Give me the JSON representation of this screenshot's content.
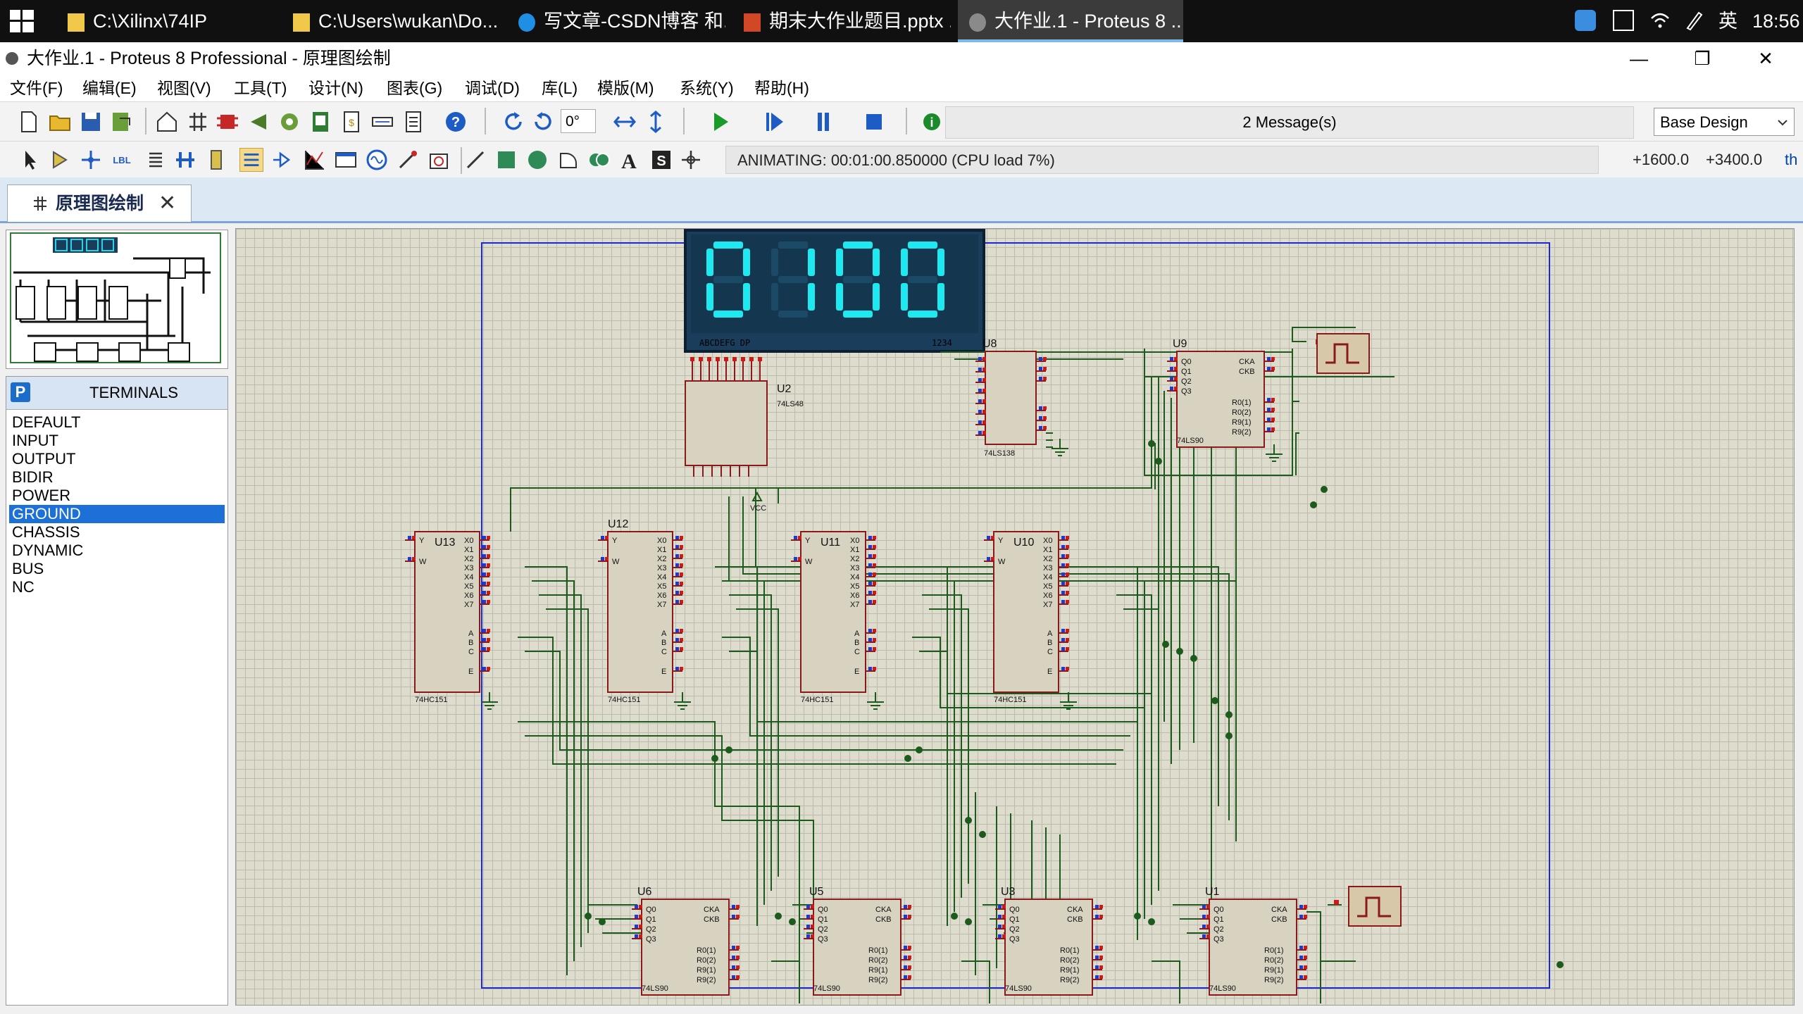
{
  "taskbar": {
    "items": [
      {
        "label": "C:\\Xilinx\\74IP",
        "icon": "folder-icon"
      },
      {
        "label": "C:\\Users\\wukan\\Do...",
        "icon": "folder-icon"
      },
      {
        "label": "写文章-CSDN博客 和...",
        "icon": "edge-browser-icon"
      },
      {
        "label": "期末大作业题目.pptx ...",
        "icon": "powerpoint-icon"
      },
      {
        "label": "大作业.1 - Proteus 8 ...",
        "icon": "proteus-icon"
      }
    ],
    "ime": "英",
    "clock": "18:56"
  },
  "window": {
    "title": "大作业.1 - Proteus 8 Professional - 原理图绘制",
    "minimize": "—",
    "restore": "❐",
    "close": "✕"
  },
  "menu": [
    "文件(F)",
    "编辑(E)",
    "视图(V)",
    "工具(T)",
    "设计(N)",
    "图表(G)",
    "调试(D)",
    "库(L)",
    "模版(M)",
    "系统(Y)",
    "帮助(H)"
  ],
  "toolbar": {
    "rotation": "0°",
    "messages": "2 Message(s)",
    "design": "Base Design"
  },
  "status": {
    "animating": "ANIMATING: 00:01:00.850000 (CPU load 7%)",
    "x": "+1600.0",
    "y": "+3400.0",
    "unit": "th"
  },
  "tab": {
    "label": "原理图绘制",
    "close": "✕"
  },
  "terminals": {
    "mode": "P",
    "title": "TERMINALS",
    "items": [
      "DEFAULT",
      "INPUT",
      "OUTPUT",
      "BIDIR",
      "POWER",
      "GROUND",
      "CHASSIS",
      "DYNAMIC",
      "BUS",
      "NC"
    ],
    "selected": "GROUND"
  },
  "schematic": {
    "display": {
      "value": "0 100",
      "digits": [
        "0",
        "",
        "1",
        "0",
        "0"
      ],
      "pin_label_left": "ABCDEFG  DP",
      "pin_label_right": "1234"
    },
    "components": [
      {
        "ref": "U2",
        "part": "74LS48"
      },
      {
        "ref": "U8",
        "part": "74LS138"
      },
      {
        "ref": "U9",
        "part": "74LS90"
      },
      {
        "ref": "U13",
        "part": "74HC151"
      },
      {
        "ref": "U12",
        "part": "74HC151"
      },
      {
        "ref": "U11",
        "part": "74HC151"
      },
      {
        "ref": "U10",
        "part": "74HC151"
      },
      {
        "ref": "U6",
        "part": "74LS90"
      },
      {
        "ref": "U5",
        "part": "74LS90"
      },
      {
        "ref": "U3",
        "part": "74LS90"
      },
      {
        "ref": "U1",
        "part": "74LS90"
      }
    ],
    "vcc_label": "VCC",
    "mux_pins_left": [
      "Y",
      "W"
    ],
    "mux_pins_right": [
      "X0",
      "X1",
      "X2",
      "X3",
      "X4",
      "X5",
      "X6",
      "X7",
      "A",
      "B",
      "C",
      "E"
    ],
    "cnt_pins": [
      "Q0",
      "Q1",
      "Q2",
      "Q3",
      "CKA",
      "CKB",
      "R0(1)",
      "R0(2)",
      "R9(1)",
      "R9(2)"
    ]
  }
}
